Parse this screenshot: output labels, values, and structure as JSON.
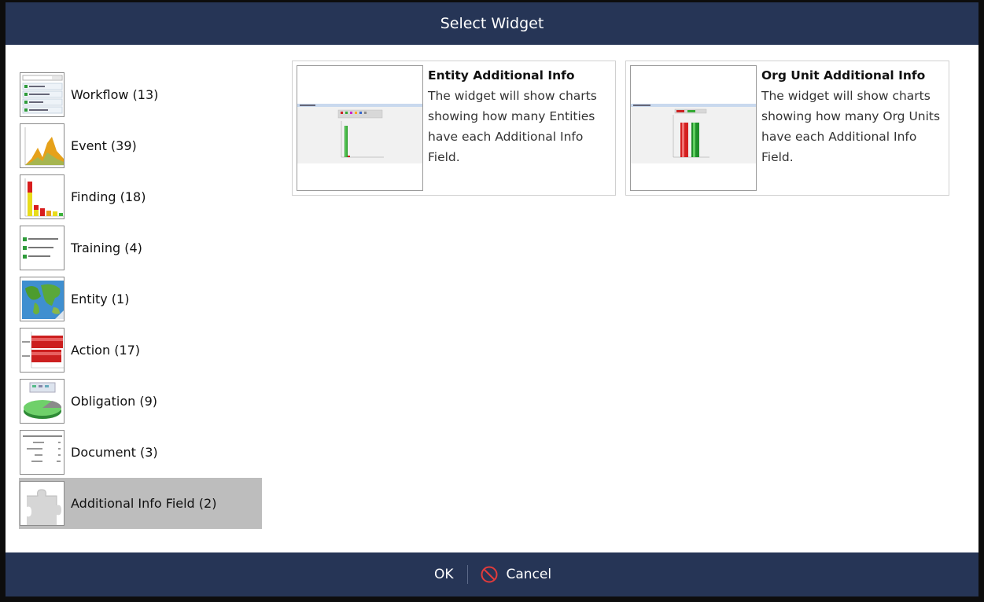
{
  "dialog": {
    "title": "Select Widget"
  },
  "categories": [
    {
      "label": "Workflow (13)",
      "icon": "workflow-list-icon"
    },
    {
      "label": "Event (39)",
      "icon": "area-chart-icon"
    },
    {
      "label": "Finding (18)",
      "icon": "bar-chart-icon"
    },
    {
      "label": "Training (4)",
      "icon": "training-list-icon"
    },
    {
      "label": "Entity (1)",
      "icon": "world-map-icon"
    },
    {
      "label": "Action (17)",
      "icon": "horizontal-bar-icon"
    },
    {
      "label": "Obligation (9)",
      "icon": "pie-chart-icon"
    },
    {
      "label": "Document (3)",
      "icon": "document-table-icon"
    },
    {
      "label": "Additional Info Field (2)",
      "icon": "puzzle-piece-icon",
      "selected": true
    }
  ],
  "widgets": [
    {
      "title": "Entity Additional Info",
      "description": "The widget will show charts showing how many Entities have each Additional Info Field."
    },
    {
      "title": "Org Unit Additional Info",
      "description": "The widget will show charts showing how many Org Units have each Additional Info Field."
    }
  ],
  "footer": {
    "ok_label": "OK",
    "cancel_label": "Cancel"
  },
  "colors": {
    "header": "#263556",
    "selected": "#bdbdbd"
  }
}
